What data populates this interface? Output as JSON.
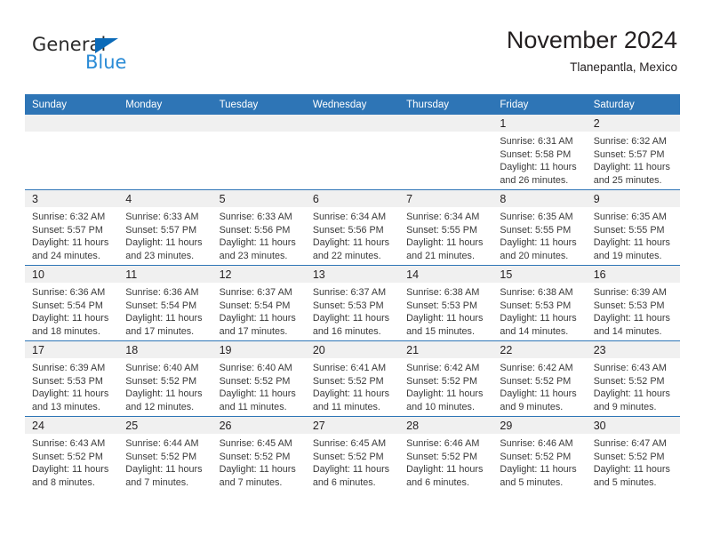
{
  "brand": {
    "name_part1": "General",
    "name_part2": "Blue",
    "accent_color": "#2a8bd6",
    "triangle_color": "#0b6ab8",
    "logo_icon": "blue-triangle-icon"
  },
  "header": {
    "title": "November 2024",
    "subtitle": "Tlanepantla, Mexico"
  },
  "theme": {
    "header_row_color": "#2e75b6",
    "date_band_color": "#f0f0f0",
    "text_color": "#231f20"
  },
  "calendar": {
    "weekday_headers": [
      "Sunday",
      "Monday",
      "Tuesday",
      "Wednesday",
      "Thursday",
      "Friday",
      "Saturday"
    ],
    "weeks": [
      [
        {
          "day": "",
          "empty": true,
          "lines": []
        },
        {
          "day": "",
          "empty": true,
          "lines": []
        },
        {
          "day": "",
          "empty": true,
          "lines": []
        },
        {
          "day": "",
          "empty": true,
          "lines": []
        },
        {
          "day": "",
          "empty": true,
          "lines": []
        },
        {
          "day": "1",
          "empty": false,
          "lines": [
            "Sunrise: 6:31 AM",
            "Sunset: 5:58 PM",
            "Daylight: 11 hours",
            "and 26 minutes."
          ]
        },
        {
          "day": "2",
          "empty": false,
          "lines": [
            "Sunrise: 6:32 AM",
            "Sunset: 5:57 PM",
            "Daylight: 11 hours",
            "and 25 minutes."
          ]
        }
      ],
      [
        {
          "day": "3",
          "empty": false,
          "lines": [
            "Sunrise: 6:32 AM",
            "Sunset: 5:57 PM",
            "Daylight: 11 hours",
            "and 24 minutes."
          ]
        },
        {
          "day": "4",
          "empty": false,
          "lines": [
            "Sunrise: 6:33 AM",
            "Sunset: 5:57 PM",
            "Daylight: 11 hours",
            "and 23 minutes."
          ]
        },
        {
          "day": "5",
          "empty": false,
          "lines": [
            "Sunrise: 6:33 AM",
            "Sunset: 5:56 PM",
            "Daylight: 11 hours",
            "and 23 minutes."
          ]
        },
        {
          "day": "6",
          "empty": false,
          "lines": [
            "Sunrise: 6:34 AM",
            "Sunset: 5:56 PM",
            "Daylight: 11 hours",
            "and 22 minutes."
          ]
        },
        {
          "day": "7",
          "empty": false,
          "lines": [
            "Sunrise: 6:34 AM",
            "Sunset: 5:55 PM",
            "Daylight: 11 hours",
            "and 21 minutes."
          ]
        },
        {
          "day": "8",
          "empty": false,
          "lines": [
            "Sunrise: 6:35 AM",
            "Sunset: 5:55 PM",
            "Daylight: 11 hours",
            "and 20 minutes."
          ]
        },
        {
          "day": "9",
          "empty": false,
          "lines": [
            "Sunrise: 6:35 AM",
            "Sunset: 5:55 PM",
            "Daylight: 11 hours",
            "and 19 minutes."
          ]
        }
      ],
      [
        {
          "day": "10",
          "empty": false,
          "lines": [
            "Sunrise: 6:36 AM",
            "Sunset: 5:54 PM",
            "Daylight: 11 hours",
            "and 18 minutes."
          ]
        },
        {
          "day": "11",
          "empty": false,
          "lines": [
            "Sunrise: 6:36 AM",
            "Sunset: 5:54 PM",
            "Daylight: 11 hours",
            "and 17 minutes."
          ]
        },
        {
          "day": "12",
          "empty": false,
          "lines": [
            "Sunrise: 6:37 AM",
            "Sunset: 5:54 PM",
            "Daylight: 11 hours",
            "and 17 minutes."
          ]
        },
        {
          "day": "13",
          "empty": false,
          "lines": [
            "Sunrise: 6:37 AM",
            "Sunset: 5:53 PM",
            "Daylight: 11 hours",
            "and 16 minutes."
          ]
        },
        {
          "day": "14",
          "empty": false,
          "lines": [
            "Sunrise: 6:38 AM",
            "Sunset: 5:53 PM",
            "Daylight: 11 hours",
            "and 15 minutes."
          ]
        },
        {
          "day": "15",
          "empty": false,
          "lines": [
            "Sunrise: 6:38 AM",
            "Sunset: 5:53 PM",
            "Daylight: 11 hours",
            "and 14 minutes."
          ]
        },
        {
          "day": "16",
          "empty": false,
          "lines": [
            "Sunrise: 6:39 AM",
            "Sunset: 5:53 PM",
            "Daylight: 11 hours",
            "and 14 minutes."
          ]
        }
      ],
      [
        {
          "day": "17",
          "empty": false,
          "lines": [
            "Sunrise: 6:39 AM",
            "Sunset: 5:53 PM",
            "Daylight: 11 hours",
            "and 13 minutes."
          ]
        },
        {
          "day": "18",
          "empty": false,
          "lines": [
            "Sunrise: 6:40 AM",
            "Sunset: 5:52 PM",
            "Daylight: 11 hours",
            "and 12 minutes."
          ]
        },
        {
          "day": "19",
          "empty": false,
          "lines": [
            "Sunrise: 6:40 AM",
            "Sunset: 5:52 PM",
            "Daylight: 11 hours",
            "and 11 minutes."
          ]
        },
        {
          "day": "20",
          "empty": false,
          "lines": [
            "Sunrise: 6:41 AM",
            "Sunset: 5:52 PM",
            "Daylight: 11 hours",
            "and 11 minutes."
          ]
        },
        {
          "day": "21",
          "empty": false,
          "lines": [
            "Sunrise: 6:42 AM",
            "Sunset: 5:52 PM",
            "Daylight: 11 hours",
            "and 10 minutes."
          ]
        },
        {
          "day": "22",
          "empty": false,
          "lines": [
            "Sunrise: 6:42 AM",
            "Sunset: 5:52 PM",
            "Daylight: 11 hours",
            "and 9 minutes."
          ]
        },
        {
          "day": "23",
          "empty": false,
          "lines": [
            "Sunrise: 6:43 AM",
            "Sunset: 5:52 PM",
            "Daylight: 11 hours",
            "and 9 minutes."
          ]
        }
      ],
      [
        {
          "day": "24",
          "empty": false,
          "lines": [
            "Sunrise: 6:43 AM",
            "Sunset: 5:52 PM",
            "Daylight: 11 hours",
            "and 8 minutes."
          ]
        },
        {
          "day": "25",
          "empty": false,
          "lines": [
            "Sunrise: 6:44 AM",
            "Sunset: 5:52 PM",
            "Daylight: 11 hours",
            "and 7 minutes."
          ]
        },
        {
          "day": "26",
          "empty": false,
          "lines": [
            "Sunrise: 6:45 AM",
            "Sunset: 5:52 PM",
            "Daylight: 11 hours",
            "and 7 minutes."
          ]
        },
        {
          "day": "27",
          "empty": false,
          "lines": [
            "Sunrise: 6:45 AM",
            "Sunset: 5:52 PM",
            "Daylight: 11 hours",
            "and 6 minutes."
          ]
        },
        {
          "day": "28",
          "empty": false,
          "lines": [
            "Sunrise: 6:46 AM",
            "Sunset: 5:52 PM",
            "Daylight: 11 hours",
            "and 6 minutes."
          ]
        },
        {
          "day": "29",
          "empty": false,
          "lines": [
            "Sunrise: 6:46 AM",
            "Sunset: 5:52 PM",
            "Daylight: 11 hours",
            "and 5 minutes."
          ]
        },
        {
          "day": "30",
          "empty": false,
          "lines": [
            "Sunrise: 6:47 AM",
            "Sunset: 5:52 PM",
            "Daylight: 11 hours",
            "and 5 minutes."
          ]
        }
      ]
    ]
  }
}
